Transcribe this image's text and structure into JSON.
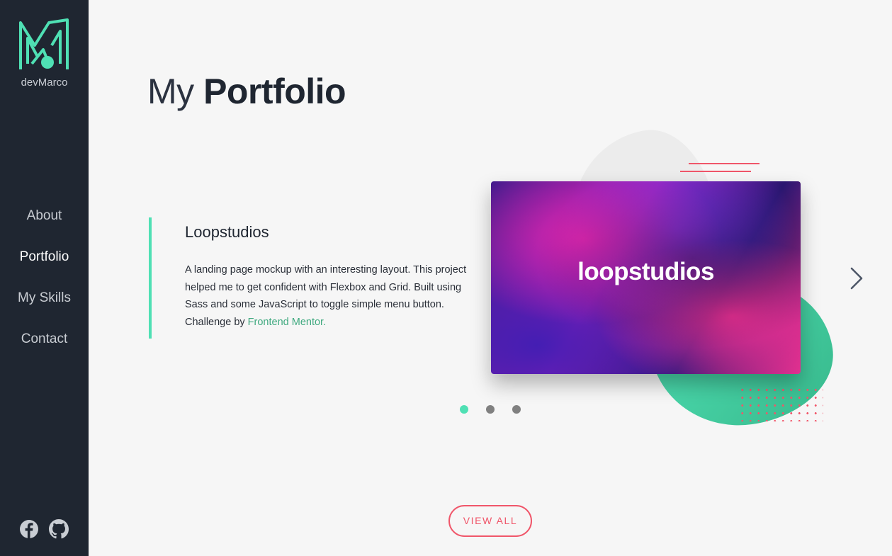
{
  "brand": {
    "name": "devMarco",
    "logo_icon": "dm-monogram-icon",
    "accent": "#4fe0b4"
  },
  "nav": {
    "items": [
      {
        "label": "About"
      },
      {
        "label": "Portfolio",
        "active": true
      },
      {
        "label": "My Skills"
      },
      {
        "label": "Contact"
      }
    ]
  },
  "social": {
    "icons": [
      "facebook-icon",
      "github-icon"
    ]
  },
  "page": {
    "title_light": "My",
    "title_bold": "Portfolio"
  },
  "project": {
    "name": "Loopstudios",
    "description": "A landing page mockup with an interesting layout. This project helped me to get confident with Flexbox and Grid. Built using Sass and some JavaScript to toggle simple menu button. Challenge by ",
    "link_text": "Frontend Mentor.",
    "preview_text": "loopstudios"
  },
  "carousel": {
    "next_icon": "chevron-right-icon",
    "slide_count": 3,
    "active_slide": 1
  },
  "actions": {
    "view_all": "VIEW ALL"
  },
  "colors": {
    "sidebar": "#1f2631",
    "background": "#f6f6f6",
    "accent_green": "#4fe0b4",
    "accent_red": "#f0566a"
  }
}
